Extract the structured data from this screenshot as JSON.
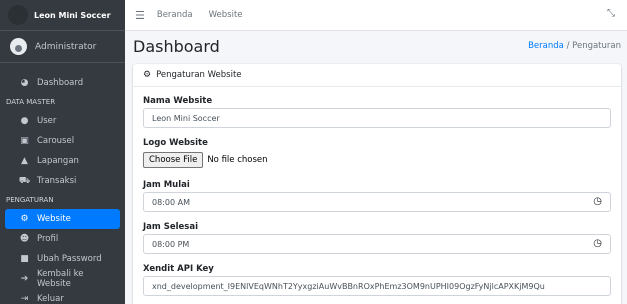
{
  "sidebar": {
    "brand": "Leon Mini Soccer",
    "user": "Administrator",
    "items": [
      {
        "label": "Dashboard",
        "icon": "tachometer-icon"
      },
      {
        "header": "DATA MASTER"
      },
      {
        "label": "User",
        "icon": "users-icon"
      },
      {
        "label": "Carousel",
        "icon": "image-icon"
      },
      {
        "label": "Lapangan",
        "icon": "building-icon"
      },
      {
        "label": "Transaksi",
        "icon": "cart-icon"
      },
      {
        "header": "PENGATURAN"
      },
      {
        "label": "Website",
        "icon": "cogs-icon",
        "active": true
      },
      {
        "label": "Profil",
        "icon": "user-tie-icon"
      },
      {
        "label": "Ubah Password",
        "icon": "lock-icon"
      },
      {
        "label": "Kembali ke Website",
        "icon": "arrow-circle-icon"
      },
      {
        "label": "Keluar",
        "icon": "sign-out-icon"
      }
    ]
  },
  "topbar": {
    "links": [
      "Beranda",
      "Website"
    ]
  },
  "content": {
    "title": "Dashboard",
    "breadcrumb": {
      "link": "Beranda",
      "separator": "/",
      "current": "Pengaturan"
    }
  },
  "card": {
    "title": "Pengaturan Website",
    "fields": {
      "nama_website": {
        "label": "Nama Website",
        "value": "Leon Mini Soccer"
      },
      "logo_website": {
        "label": "Logo Website",
        "button": "Choose File",
        "status": "No file chosen"
      },
      "jam_mulai": {
        "label": "Jam Mulai",
        "value": "08:00 AM"
      },
      "jam_selesai": {
        "label": "Jam Selesai",
        "value": "08:00 PM"
      },
      "xendit": {
        "label": "Xendit API Key",
        "value": "xnd_development_I9ENlVEqWNhT2YyxgziAuWvBBnROxPhEmz3OM9nUPHI09OgzFyNjlcAPXKjM9Qu"
      }
    }
  },
  "colors": {
    "sidebar_bg": "#343a40",
    "active": "#007bff",
    "content_bg": "#f4f6f9"
  }
}
